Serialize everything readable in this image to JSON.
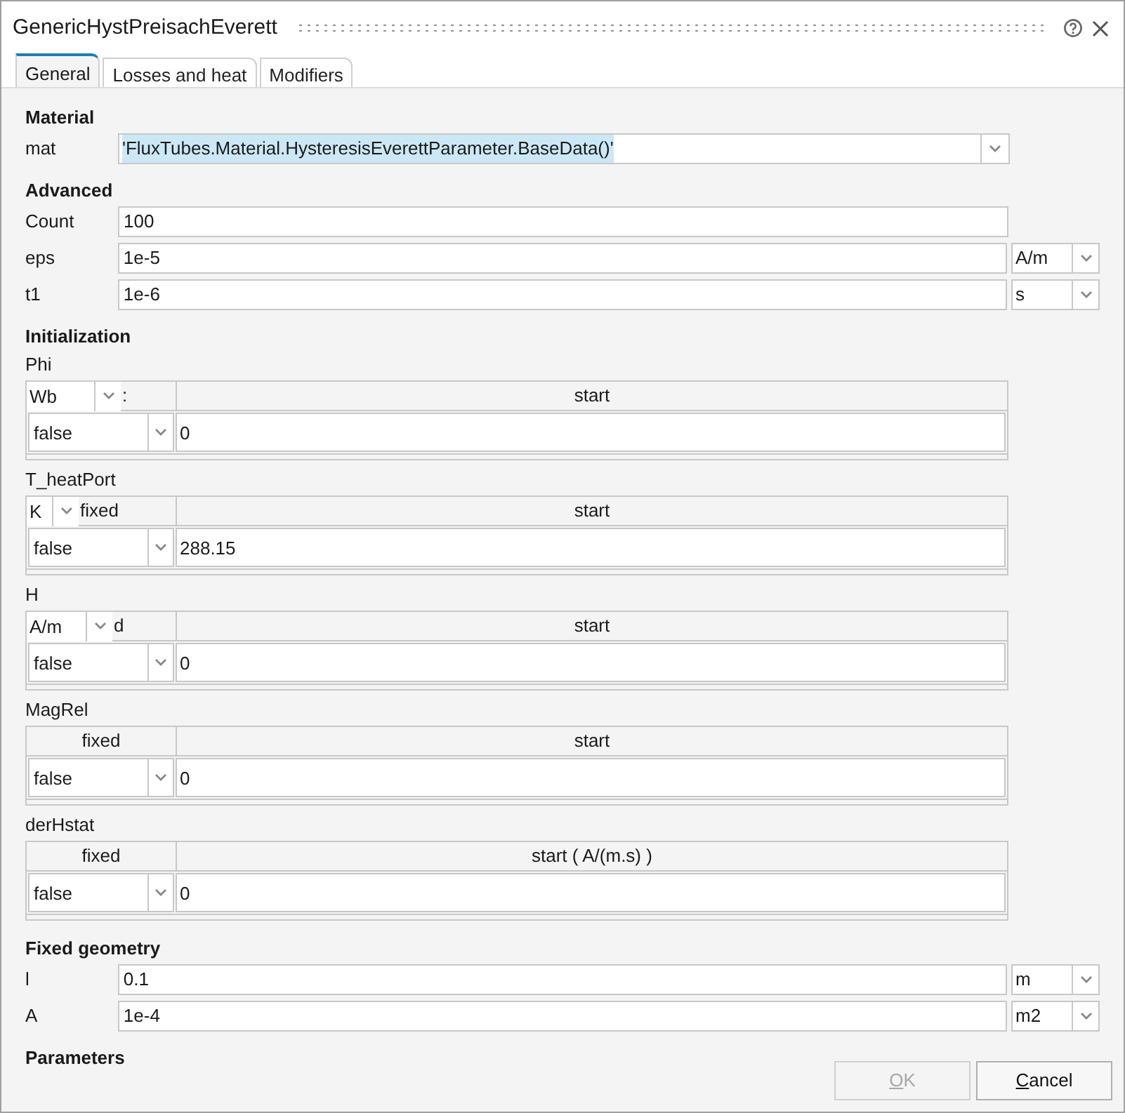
{
  "dialog": {
    "title": "GenericHystPreisachEverett"
  },
  "tabs": [
    {
      "label": "General",
      "selected": true
    },
    {
      "label": "Losses and heat",
      "selected": false
    },
    {
      "label": "Modifiers",
      "selected": false
    }
  ],
  "sections": [
    {
      "heading": "Material",
      "items": [
        {
          "kind": "combo",
          "label": "mat",
          "value": "'FluxTubes.Material.HysteresisEverettParameter.BaseData()'",
          "text_selected": true
        }
      ]
    },
    {
      "heading": "Advanced",
      "items": [
        {
          "kind": "field",
          "label": "Count",
          "value": "100"
        },
        {
          "kind": "unit_field",
          "label": "eps",
          "value": "1e-5",
          "unit": "A/m"
        },
        {
          "kind": "unit_field",
          "label": "t1",
          "value": "1e-6",
          "unit": "s"
        }
      ]
    },
    {
      "heading": "Initialization",
      "items": [
        {
          "kind": "table",
          "label": "Phi",
          "unit": "Wb",
          "fixed_header": ":",
          "start_header": "start",
          "fixed_value": "false",
          "start_value": "0"
        },
        {
          "kind": "table",
          "label": "T_heatPort",
          "unit": "K",
          "fixed_header": "fixed",
          "start_header": "start",
          "fixed_value": "false",
          "start_value": "288.15"
        },
        {
          "kind": "table",
          "label": "H",
          "unit": "A/m",
          "fixed_header": "d",
          "start_header": "start",
          "fixed_value": "false",
          "start_value": "0"
        },
        {
          "kind": "table",
          "label": "MagRel",
          "fixed_header": "fixed",
          "start_header": "start",
          "fixed_value": "false",
          "start_value": "0"
        },
        {
          "kind": "table",
          "label": "derHstat",
          "fixed_header": "fixed",
          "start_header": "start ( A/(m.s) )",
          "fixed_value": "false",
          "start_value": "0"
        }
      ]
    },
    {
      "heading": "Fixed geometry",
      "items": [
        {
          "kind": "unit_field",
          "label": "l",
          "value": "0.1",
          "unit": "m"
        },
        {
          "kind": "unit_field",
          "label": "A",
          "value": "1e-4",
          "unit": "m2"
        }
      ]
    },
    {
      "heading": "Parameters"
    }
  ],
  "buttons": [
    {
      "label": "OK",
      "disabled": true
    },
    {
      "label": "Cancel",
      "disabled": false
    }
  ]
}
